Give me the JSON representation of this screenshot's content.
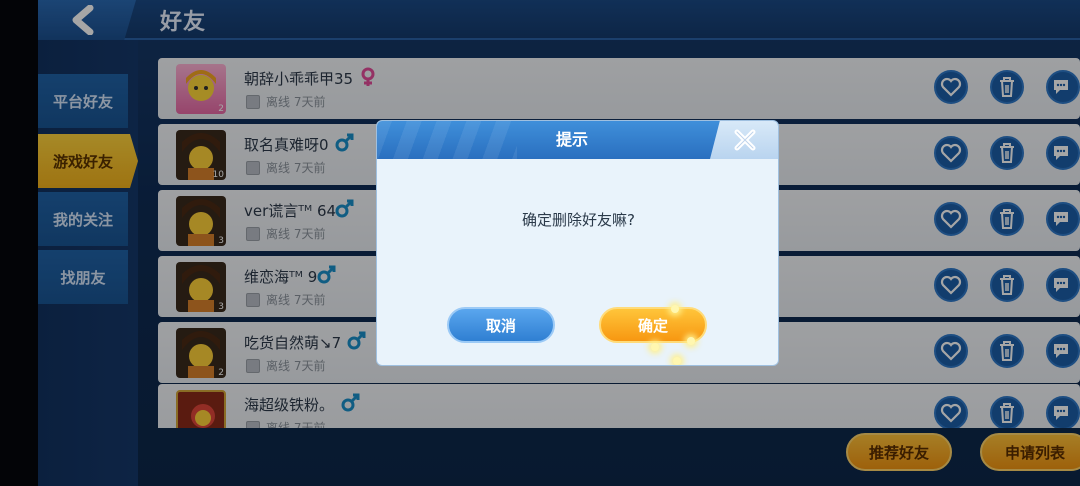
{
  "header": {
    "title": "好友",
    "back_icon": "chevron-left-icon"
  },
  "sidenav": {
    "items": [
      {
        "label": "平台好友",
        "active": false
      },
      {
        "label": "游戏好友",
        "active": true
      },
      {
        "label": "我的关注",
        "active": false
      },
      {
        "label": "找朋友",
        "active": false
      }
    ]
  },
  "friends": [
    {
      "name": "朝辞小乖乖甲35",
      "gender": "female",
      "status": "离线 7天前",
      "level": "2"
    },
    {
      "name": "取名真难呀0",
      "gender": "male",
      "status": "离线 7天前",
      "level": "10"
    },
    {
      "name": "ver谎言ᵀᴹ 64",
      "gender": "male",
      "status": "离线 7天前",
      "level": "3"
    },
    {
      "name": "维恋海ᵀᴹ 9",
      "gender": "male",
      "status": "离线 7天前",
      "level": "3"
    },
    {
      "name": "吃货自然萌↘7",
      "gender": "male",
      "status": "离线 7天前",
      "level": "2"
    },
    {
      "name": "海超级铁粉。",
      "gender": "male",
      "status": "离线 7天前",
      "level": ""
    }
  ],
  "row_actions": [
    "heart-icon",
    "trash-icon",
    "chat-icon"
  ],
  "bottom": {
    "recommend_label": "推荐好友",
    "requests_label": "申请列表"
  },
  "dialog": {
    "title": "提示",
    "message": "确定删除好友嘛?",
    "cancel_label": "取消",
    "confirm_label": "确定"
  },
  "colors": {
    "female": "#e34c9a",
    "male": "#1a8fc9",
    "accent_orange": "#f7a21b",
    "accent_blue": "#2f7fd2"
  }
}
